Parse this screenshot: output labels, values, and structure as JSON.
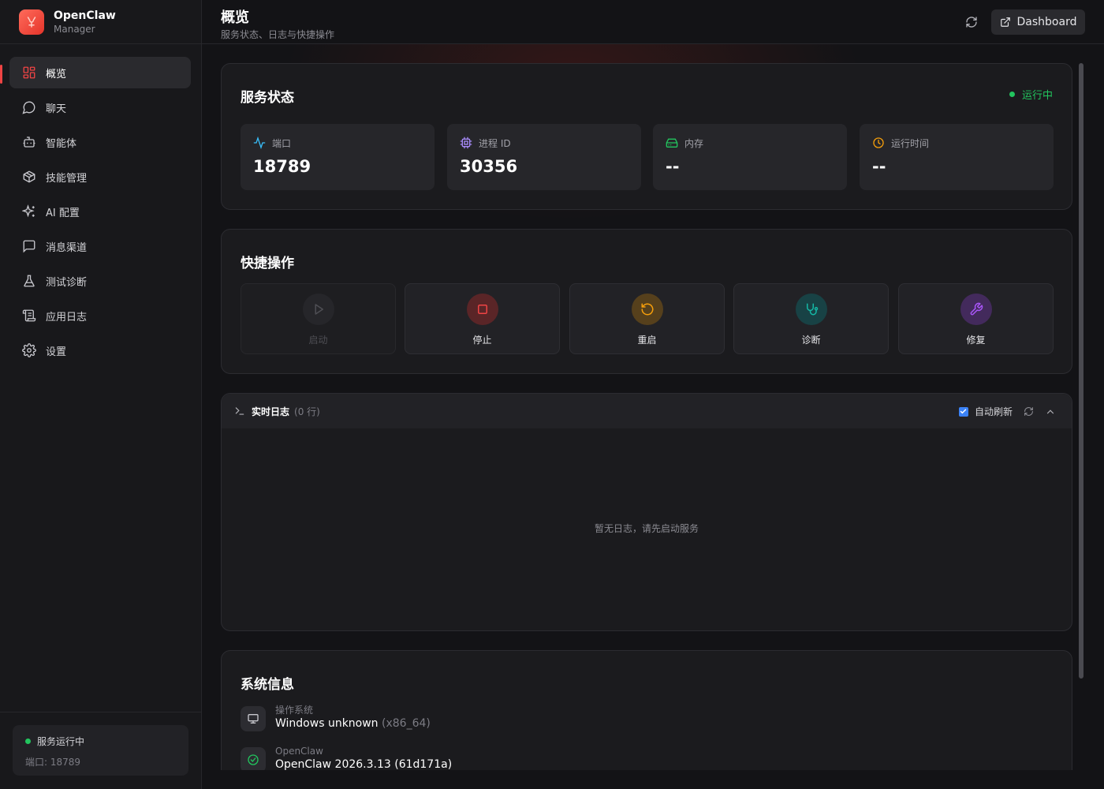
{
  "brand": {
    "name": "OpenClaw",
    "sub": "Manager"
  },
  "sidebar": {
    "items": [
      {
        "label": "概览",
        "icon": "dashboard-grid-icon",
        "active": true
      },
      {
        "label": "聊天",
        "icon": "chat-bubble-icon"
      },
      {
        "label": "智能体",
        "icon": "robot-icon"
      },
      {
        "label": "技能管理",
        "icon": "package-icon"
      },
      {
        "label": "AI 配置",
        "icon": "sparkles-icon"
      },
      {
        "label": "消息渠道",
        "icon": "message-square-icon"
      },
      {
        "label": "测试诊断",
        "icon": "flask-icon"
      },
      {
        "label": "应用日志",
        "icon": "scroll-icon"
      },
      {
        "label": "设置",
        "icon": "gear-icon"
      }
    ],
    "footer": {
      "status": "服务运行中",
      "port": "端口: 18789"
    }
  },
  "header": {
    "title": "概览",
    "subtitle": "服务状态、日志与快捷操作",
    "dashboard_label": "Dashboard"
  },
  "service": {
    "title": "服务状态",
    "status": "运行中",
    "stats": [
      {
        "label": "端口",
        "value": "18789",
        "icon": "activity-icon",
        "color": "#38bdf8"
      },
      {
        "label": "进程 ID",
        "value": "30356",
        "icon": "cpu-icon",
        "color": "#a78bfa"
      },
      {
        "label": "内存",
        "value": "--",
        "icon": "hard-drive-icon",
        "color": "#22c55e"
      },
      {
        "label": "运行时间",
        "value": "--",
        "icon": "clock-icon",
        "color": "#f59e0b"
      }
    ]
  },
  "quick": {
    "title": "快捷操作",
    "actions": [
      {
        "label": "启动",
        "disabled": true,
        "icon": "play-icon"
      },
      {
        "label": "停止",
        "icon": "stop-icon",
        "color": "#ef4444"
      },
      {
        "label": "重启",
        "icon": "rotate-icon",
        "color": "#f59e0b"
      },
      {
        "label": "诊断",
        "icon": "stethoscope-icon",
        "color": "#14b8a6"
      },
      {
        "label": "修复",
        "icon": "wrench-icon",
        "color": "#a855f7"
      }
    ]
  },
  "logs": {
    "title": "实时日志",
    "count": "(0 行)",
    "auto_refresh": "自动刷新",
    "auto_refresh_checked": true,
    "empty": "暂无日志，请先启动服务"
  },
  "sysinfo": {
    "title": "系统信息",
    "os_label": "操作系统",
    "os_value": "Windows unknown",
    "os_arch": "(x86_64)",
    "app_label": "OpenClaw",
    "app_value": "OpenClaw 2026.3.13 (61d171a)"
  }
}
